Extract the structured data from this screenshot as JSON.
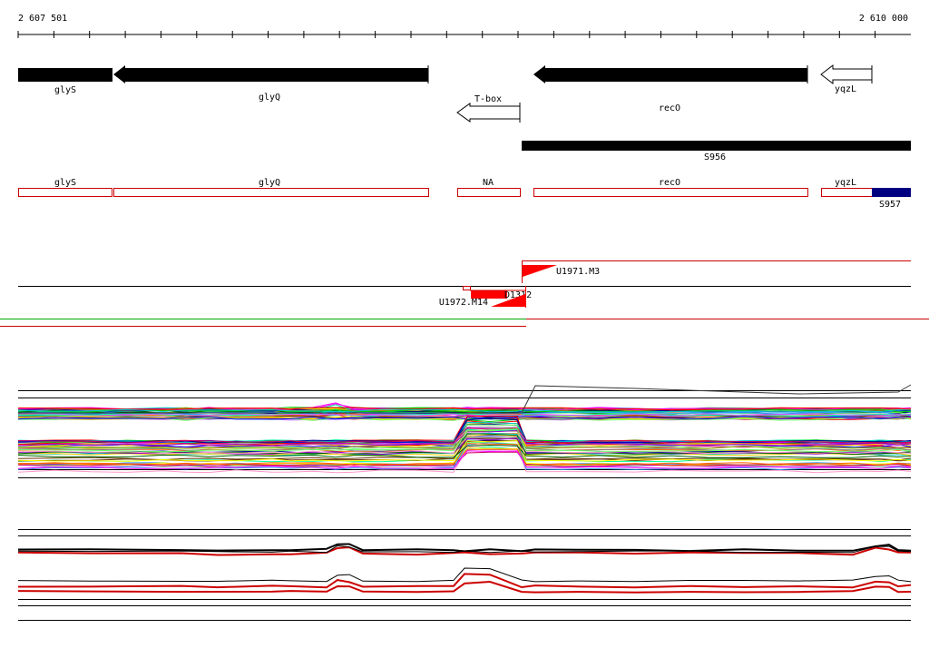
{
  "ruler": {
    "start_label": "2 607 501",
    "end_label": "2 610 000"
  },
  "genes": [
    {
      "id": "glyS",
      "label": "glyS"
    },
    {
      "id": "glyQ",
      "label": "glyQ"
    },
    {
      "id": "tbox",
      "label": "T-box"
    },
    {
      "id": "recO",
      "label": "recO"
    },
    {
      "id": "yqzL",
      "label": "yqzL"
    }
  ],
  "segment": {
    "label": "S956"
  },
  "transcripts": [
    {
      "id": "glyS",
      "label": "glyS"
    },
    {
      "id": "glyQ",
      "label": "glyQ"
    },
    {
      "id": "na",
      "label": "NA"
    },
    {
      "id": "recO",
      "label": "recO"
    },
    {
      "id": "yqzL",
      "label": "yqzL"
    },
    {
      "id": "s957",
      "label": "S957"
    }
  ],
  "features": [
    {
      "id": "u1971",
      "label": "U1971.M3"
    },
    {
      "id": "d1312",
      "label": "D1312"
    },
    {
      "id": "u1972",
      "label": "U1972.M14"
    }
  ],
  "colors": {
    "gene_fill": "#000000",
    "transcript_outline": "#cc0000",
    "feature_red": "#ff0000",
    "s957_fill": "#000080",
    "divider_green": "#00aa00",
    "divider_red": "#cc0000"
  }
}
